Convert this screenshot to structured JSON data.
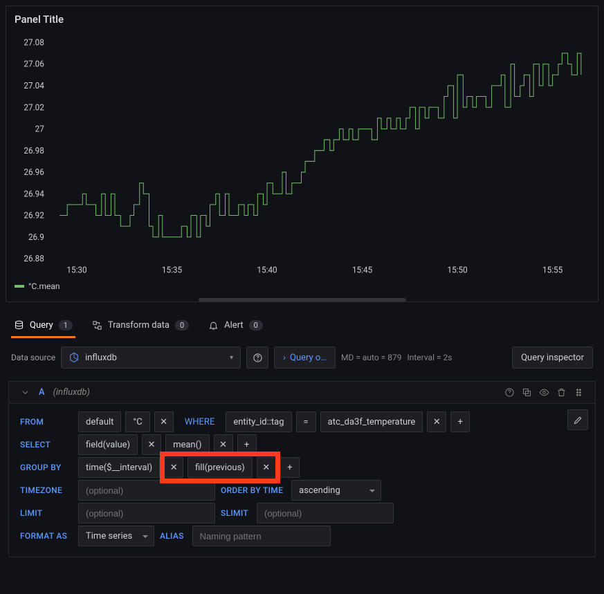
{
  "panel": {
    "title": "Panel Title"
  },
  "chart_data": {
    "type": "line",
    "title": "",
    "xlabel": "",
    "ylabel": "",
    "legend": [
      "°C.mean"
    ],
    "ylim": [
      26.88,
      27.08
    ],
    "yticks": [
      26.88,
      26.9,
      26.92,
      26.94,
      26.96,
      26.98,
      27,
      27.02,
      27.04,
      27.06,
      27.08
    ],
    "xticks": [
      "15:30",
      "15:35",
      "15:40",
      "15:45",
      "15:50",
      "15:55"
    ],
    "series": [
      {
        "name": "°C.mean",
        "color": "#73bf69",
        "x_minutes": [
          29.1,
          29.3,
          29.5,
          29.8,
          30.0,
          30.3,
          30.5,
          30.8,
          31.0,
          31.3,
          31.5,
          31.8,
          32.0,
          32.3,
          32.5,
          32.8,
          33.0,
          33.3,
          33.5,
          33.8,
          34.0,
          34.3,
          34.5,
          34.8,
          35.0,
          35.3,
          35.5,
          35.8,
          36.0,
          36.3,
          36.5,
          36.8,
          37.0,
          37.3,
          37.5,
          37.8,
          38.0,
          38.3,
          38.5,
          38.8,
          39.0,
          39.3,
          39.5,
          39.8,
          40.0,
          40.3,
          40.5,
          40.8,
          41.0,
          41.3,
          41.5,
          41.8,
          42.0,
          42.3,
          42.5,
          42.8,
          43.0,
          43.3,
          43.5,
          43.8,
          44.0,
          44.3,
          44.5,
          44.8,
          45.0,
          45.3,
          45.5,
          45.8,
          46.0,
          46.3,
          46.5,
          46.8,
          47.0,
          47.3,
          47.5,
          47.8,
          48.0,
          48.3,
          48.5,
          48.8,
          49.0,
          49.3,
          49.5,
          49.8,
          50.0,
          50.3,
          50.5,
          50.8,
          51.0,
          51.3,
          51.5,
          51.8,
          52.0,
          52.3,
          52.5,
          52.8,
          53.0,
          53.3,
          53.5,
          53.8,
          54.0,
          54.3,
          54.5,
          54.8,
          55.0,
          55.3,
          55.5,
          55.8,
          56.0,
          56.3,
          56.5
        ],
        "values": [
          26.92,
          26.92,
          26.93,
          26.93,
          26.93,
          26.94,
          26.93,
          26.93,
          26.92,
          26.94,
          26.92,
          26.94,
          26.92,
          26.91,
          26.91,
          26.92,
          26.93,
          26.95,
          26.94,
          26.91,
          26.9,
          26.92,
          26.9,
          26.9,
          26.9,
          26.9,
          26.91,
          26.9,
          26.92,
          26.9,
          26.92,
          26.91,
          26.93,
          26.94,
          26.92,
          26.94,
          26.92,
          26.92,
          26.93,
          26.92,
          26.93,
          26.92,
          26.94,
          26.93,
          26.95,
          26.94,
          26.94,
          26.96,
          26.94,
          26.95,
          26.95,
          26.96,
          26.97,
          26.97,
          26.98,
          26.98,
          26.99,
          26.98,
          26.99,
          27.0,
          26.99,
          27.0,
          26.99,
          27.0,
          27.0,
          27.0,
          26.99,
          27.01,
          27.0,
          27.01,
          27.0,
          27.01,
          27.0,
          27.01,
          27.02,
          27.0,
          27.02,
          27.01,
          27.02,
          27.02,
          27.01,
          27.03,
          27.04,
          27.01,
          27.05,
          27.02,
          27.03,
          27.02,
          27.03,
          27.03,
          27.02,
          27.04,
          27.04,
          27.05,
          27.02,
          27.06,
          27.03,
          27.04,
          27.05,
          27.03,
          27.06,
          27.04,
          27.06,
          27.04,
          27.05,
          27.06,
          27.07,
          27.06,
          27.05,
          27.07,
          27.05
        ]
      }
    ]
  },
  "legend": {
    "label": "°C.mean"
  },
  "tabs": {
    "query": {
      "label": "Query",
      "count": "1"
    },
    "transform": {
      "label": "Transform data",
      "count": "0"
    },
    "alert": {
      "label": "Alert",
      "count": "0"
    }
  },
  "datasource": {
    "label": "Data source",
    "selected": "influxdb",
    "query_options_label": "Query o…",
    "md_info": "MD = auto = 879",
    "interval_info": "Interval = 2s",
    "inspector_btn": "Query inspector"
  },
  "queryHeader": {
    "id": "A",
    "ds": "(influxdb)"
  },
  "builder": {
    "from_label": "FROM",
    "from_default": "default",
    "from_measurement": "°C",
    "where_label": "WHERE",
    "where_tag": "entity_id::tag",
    "where_op": "=",
    "where_val": "atc_da3f_temperature",
    "select_label": "SELECT",
    "select_field": "field(value)",
    "select_mean": "mean()",
    "groupby_label": "GROUP BY",
    "groupby_time": "time($__interval)",
    "groupby_fill": "fill(previous)",
    "timezone_label": "TIMEZONE",
    "timezone_ph": "(optional)",
    "orderby_label": "ORDER BY TIME",
    "orderby_val": "ascending",
    "limit_label": "LIMIT",
    "limit_ph": "(optional)",
    "slimit_label": "SLIMIT",
    "slimit_ph": "(optional)",
    "format_label": "FORMAT AS",
    "format_val": "Time series",
    "alias_label": "ALIAS",
    "alias_ph": "Naming pattern"
  }
}
